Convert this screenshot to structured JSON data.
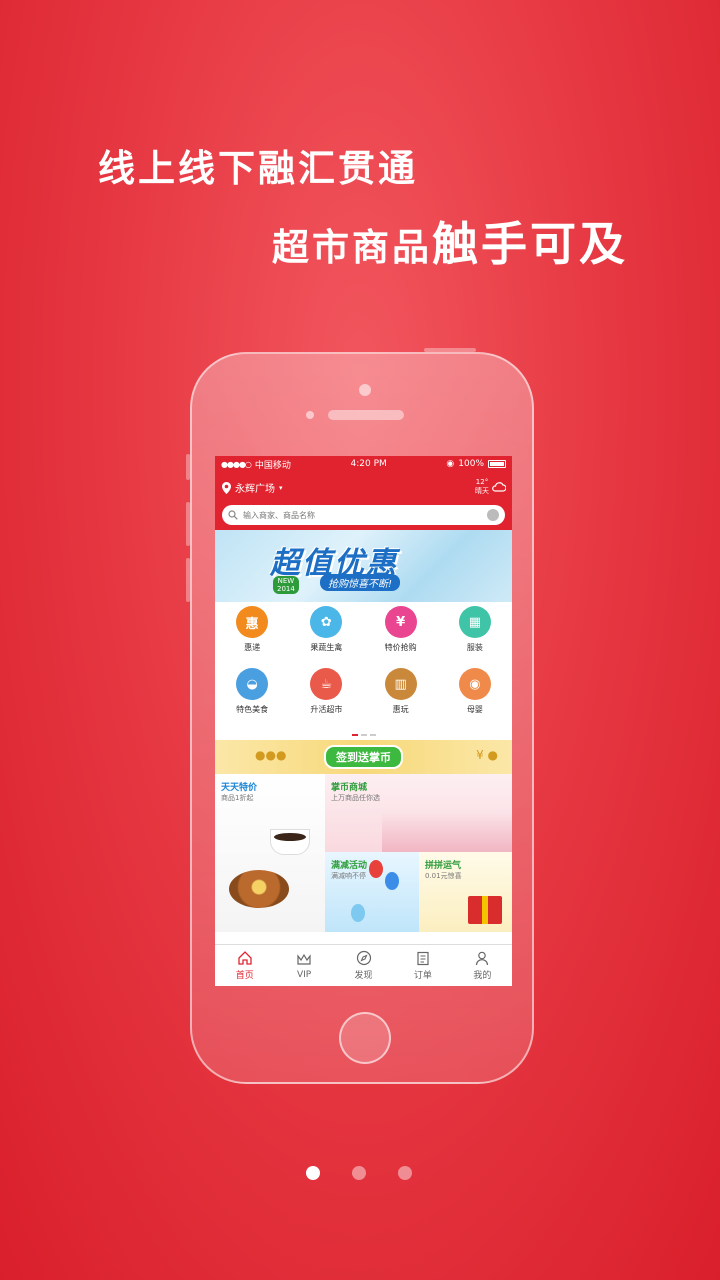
{
  "headline": {
    "line1": "线上线下融汇贯通",
    "line2_a": "超市商品",
    "line2_b": "触手可及"
  },
  "statusbar": {
    "carrier": "中国移动",
    "time": "4:20 PM",
    "battery": "100%"
  },
  "header": {
    "location": "永辉广场",
    "weather_temp": "12°",
    "weather_desc": "晴天",
    "search_placeholder": "输入商家、商品名称"
  },
  "banner": {
    "title": "超值优惠",
    "subtitle": "抢购惊喜不断!",
    "badge_line1": "NEW",
    "badge_line2": "2014"
  },
  "categories": [
    {
      "label": "惠递",
      "icon": "hui-di-icon",
      "color": "#f28a1e",
      "glyph": "惠"
    },
    {
      "label": "果蔬生禽",
      "icon": "carrot-icon",
      "color": "#4bb7e8",
      "glyph": "✿"
    },
    {
      "label": "特价抢购",
      "icon": "sale-icon",
      "color": "#e94590",
      "glyph": "¥"
    },
    {
      "label": "服装",
      "icon": "gift-icon",
      "color": "#3fc4a8",
      "glyph": "▦"
    },
    {
      "label": "特色美食",
      "icon": "dish-icon",
      "color": "#4a9fe0",
      "glyph": "◒"
    },
    {
      "label": "升活超市",
      "icon": "cup-icon",
      "color": "#ea5a4a",
      "glyph": "☕"
    },
    {
      "label": "惠玩",
      "icon": "building-icon",
      "color": "#c9883a",
      "glyph": "▥"
    },
    {
      "label": "母婴",
      "icon": "stroller-icon",
      "color": "#f08a4a",
      "glyph": "◉"
    }
  ],
  "sign_banner": {
    "text": "签到送掌币"
  },
  "promos": {
    "p1": {
      "title": "天天特价",
      "sub": "商品1折起"
    },
    "p2": {
      "title": "掌币商城",
      "sub": "上万商品任你选"
    },
    "p3": {
      "title": "满减活动",
      "sub": "满减响不停"
    },
    "p4": {
      "title": "拼拼运气",
      "sub": "0.01元惊喜"
    }
  },
  "tabs": [
    {
      "label": "首页",
      "icon": "home-icon"
    },
    {
      "label": "VIP",
      "icon": "crown-icon"
    },
    {
      "label": "发现",
      "icon": "compass-icon"
    },
    {
      "label": "订单",
      "icon": "clipboard-icon"
    },
    {
      "label": "我的",
      "icon": "user-icon"
    }
  ],
  "colors": {
    "brand": "#e1232f",
    "background": "#e73a44"
  }
}
